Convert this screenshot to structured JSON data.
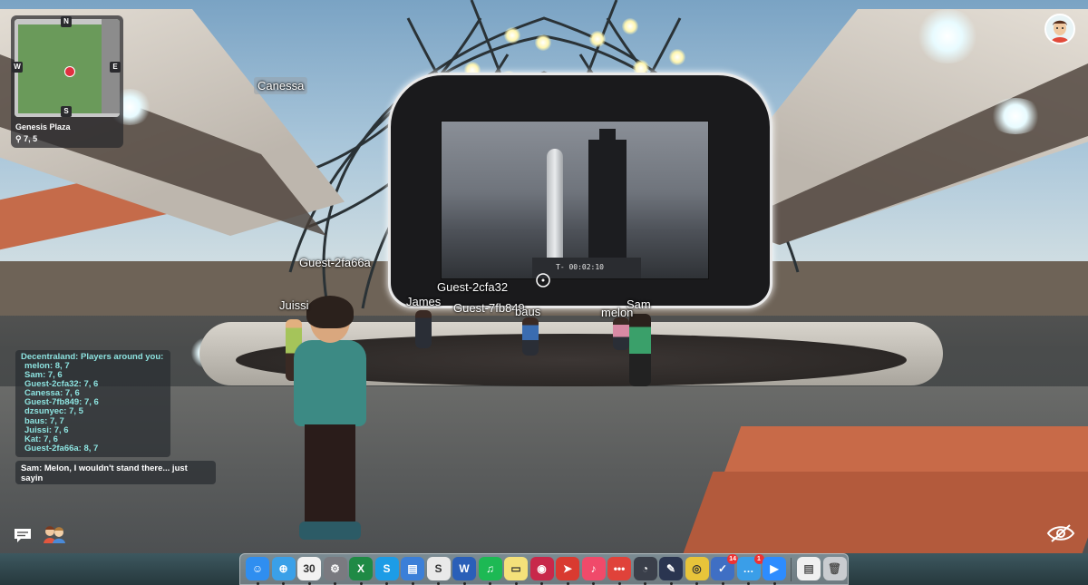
{
  "minimap": {
    "compass": {
      "n": "N",
      "s": "S",
      "e": "E",
      "w": "W"
    },
    "place": "Genesis Plaza",
    "coords": "7, 5"
  },
  "nametags": {
    "canessa": "Canessa",
    "guest_2fa66a": "Guest-2fa66a",
    "juissi": "Juissi",
    "james": "James",
    "guest_2cfa32": "Guest-2cfa32",
    "guest_7fb849": "Guest-7fb849",
    "baus": "baus",
    "sam": "Sam",
    "melon": "melon"
  },
  "screen": {
    "timer": "T- 00:02:10"
  },
  "players_panel": {
    "title": "Decentraland: Players around you:",
    "players": [
      "melon: 8, 7",
      "Sam: 7, 6",
      "Guest-2cfa32: 7, 6",
      "Canessa: 7, 6",
      "Guest-7fb849: 7, 6",
      "dzsunyec: 7, 5",
      "baus: 7, 7",
      "Juissi: 7, 6",
      "Kat: 7, 6",
      "Guest-2fa66a: 8, 7"
    ]
  },
  "chat": {
    "message": "Sam: Melon, I wouldn't stand there... just sayin"
  },
  "hud_icons": {
    "chat": "chat-bubble-icon",
    "friends": "friends-icon",
    "hide": "eye-slash-icon",
    "profile": "avatar-profile-icon"
  },
  "dock": {
    "apps": [
      {
        "name": "finder",
        "glyph": "☺",
        "color": "#2f8ef0",
        "badge": ""
      },
      {
        "name": "safari",
        "glyph": "⊕",
        "color": "#3aa0e8",
        "badge": ""
      },
      {
        "name": "calendar",
        "glyph": "30",
        "color": "#f2f2f2",
        "badge": ""
      },
      {
        "name": "system-preferences",
        "glyph": "⚙",
        "color": "#7a7a80",
        "badge": ""
      },
      {
        "name": "excel",
        "glyph": "X",
        "color": "#1f8a45",
        "badge": ""
      },
      {
        "name": "skype",
        "glyph": "S",
        "color": "#1c9ce6",
        "badge": ""
      },
      {
        "name": "notes-app",
        "glyph": "▤",
        "color": "#3b7fd8",
        "badge": ""
      },
      {
        "name": "scrivener",
        "glyph": "S",
        "color": "#e9e9e9",
        "badge": ""
      },
      {
        "name": "word",
        "glyph": "W",
        "color": "#2a5fb8",
        "badge": ""
      },
      {
        "name": "spotify",
        "glyph": "♫",
        "color": "#1db954",
        "badge": ""
      },
      {
        "name": "stickies",
        "glyph": "▭",
        "color": "#f4e17a",
        "badge": ""
      },
      {
        "name": "lips-app",
        "glyph": "◉",
        "color": "#c8284a",
        "badge": ""
      },
      {
        "name": "bird-app",
        "glyph": "➤",
        "color": "#d93a30",
        "badge": ""
      },
      {
        "name": "music",
        "glyph": "♪",
        "color": "#f04a6a",
        "badge": ""
      },
      {
        "name": "more-app",
        "glyph": "•••",
        "color": "#e0423a",
        "badge": ""
      },
      {
        "name": "wifi-app",
        "glyph": "◔",
        "color": "#3a3f4a",
        "badge": ""
      },
      {
        "name": "sketch-app",
        "glyph": "✎",
        "color": "#2a3550",
        "badge": ""
      },
      {
        "name": "chrome",
        "glyph": "◎",
        "color": "#e8c43a",
        "badge": ""
      },
      {
        "name": "tasks-app",
        "glyph": "✓",
        "color": "#3f6fc4",
        "badge": "14"
      },
      {
        "name": "messages",
        "glyph": "…",
        "color": "#3a9ee8",
        "badge": "1"
      },
      {
        "name": "zoom",
        "glyph": "▶",
        "color": "#2d8cff",
        "badge": ""
      }
    ],
    "right": [
      {
        "name": "documents",
        "glyph": "▤",
        "color": "#f0f0f0"
      },
      {
        "name": "trash",
        "glyph": "🗑",
        "color": "#c9ccd0"
      }
    ]
  },
  "colors": {
    "player_text": "#8de3e0",
    "deck_orange": "#c86a48",
    "minimap_green": "#6a9a5a",
    "marker_red": "#e03040"
  }
}
